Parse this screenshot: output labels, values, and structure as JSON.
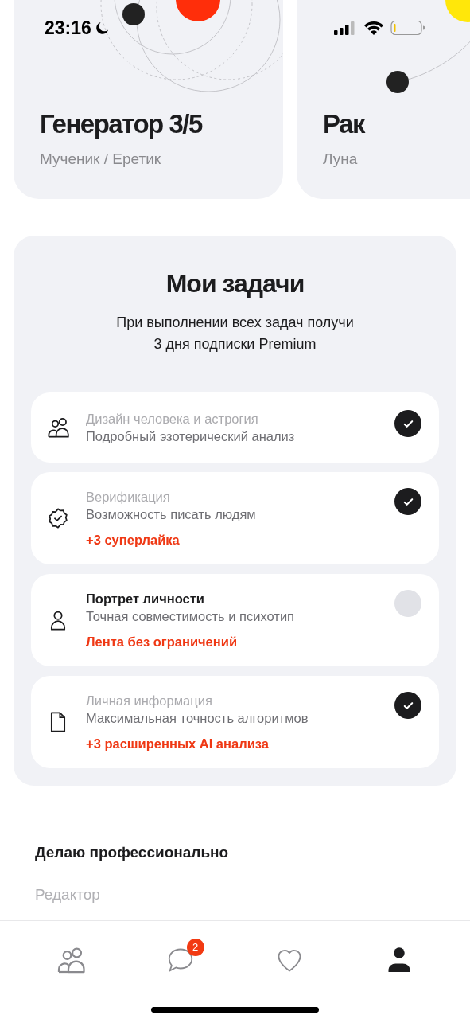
{
  "status_bar": {
    "time": "23:16"
  },
  "cards": [
    {
      "title": "Генератор 3/5",
      "subtitle": "Мученик / Еретик",
      "kind": "orbits"
    },
    {
      "title": "Рак",
      "subtitle": "Луна",
      "kind": "moon"
    }
  ],
  "tasks_panel": {
    "title": "Мои задачи",
    "description": "При выполнении всех задач получи\n3 дня подписки Premium",
    "tasks": [
      {
        "kind": "people",
        "title": "Дизайн человека и астрогия",
        "subtitle": "Подробный эзотерический анализ",
        "done": true
      },
      {
        "kind": "badge",
        "title": "Верификация",
        "subtitle": "Возможность писать людям",
        "reward": "+3 суперлайка",
        "done": true
      },
      {
        "kind": "person",
        "title": "Портрет личности",
        "subtitle": "Точная совместимость и психотип",
        "reward": "Лента без ограничений",
        "done": false
      },
      {
        "kind": "document",
        "title": "Личная информация",
        "subtitle": "Максимальная точность алгоритмов",
        "reward": "+3 расширенных AI анализа",
        "done": true
      }
    ]
  },
  "profession": {
    "label": "Делаю профессионально",
    "placeholder": "Редактор"
  },
  "tab_bar": [
    {
      "kind": "people",
      "selected": false
    },
    {
      "kind": "chat",
      "selected": false,
      "badge": "2"
    },
    {
      "kind": "heart",
      "selected": false
    },
    {
      "kind": "profile",
      "selected": true
    }
  ]
}
